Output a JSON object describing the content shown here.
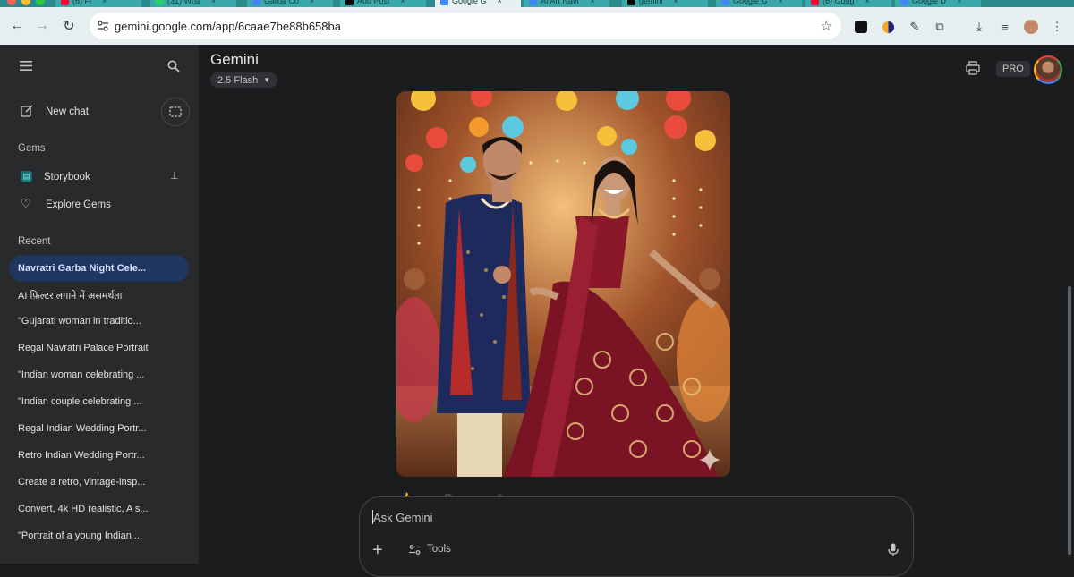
{
  "browser": {
    "tabs": [
      {
        "label": "(6) Fi",
        "favicon_color": "#ff0033"
      },
      {
        "label": "(31) Wha",
        "favicon_color": "#25d366"
      },
      {
        "label": "Garba Co",
        "favicon_color": "#4285f4"
      },
      {
        "label": "Add Post",
        "favicon_color": "#000000"
      },
      {
        "label": "Google G",
        "favicon_color": "#4285f4"
      },
      {
        "label": "AI Art Navr",
        "favicon_color": "#4285f4"
      },
      {
        "label": "gemini",
        "favicon_color": "#000000"
      },
      {
        "label": "Google G",
        "favicon_color": "#4285f4"
      },
      {
        "label": "(6) Goog",
        "favicon_color": "#ff0033"
      },
      {
        "label": "Google D",
        "favicon_color": "#4285f4"
      }
    ],
    "url": "gemini.google.com/app/6caae7be88b658ba"
  },
  "sidebar": {
    "new_chat": "New chat",
    "gems_header": "Gems",
    "gems": [
      {
        "label": "Storybook"
      },
      {
        "label": "Explore Gems"
      }
    ],
    "recent_header": "Recent",
    "recent": [
      "Navratri Garba Night Cele...",
      "AI फ़िल्टर लगाने में असमर्थता",
      "\"Gujarati woman in traditio...",
      "Regal Navratri Palace Portrait",
      "\"Indian woman celebrating ...",
      "\"Indian couple celebrating ...",
      "Regal Indian Wedding Portr...",
      "Retro Indian Wedding Portr...",
      "Create a retro, vintage-insp...",
      "Convert, 4k HD realistic, A s...",
      "\"Portrait of a young Indian ..."
    ]
  },
  "main": {
    "brand": "Gemini",
    "model": "2.5 Flash",
    "pro_badge": "PRO"
  },
  "composer": {
    "placeholder": "Ask Gemini",
    "tools_label": "Tools"
  },
  "colors": {
    "accent_active": "#1f3760",
    "sidebar_bg": "#282a2c",
    "main_bg": "#1b1c1d"
  }
}
